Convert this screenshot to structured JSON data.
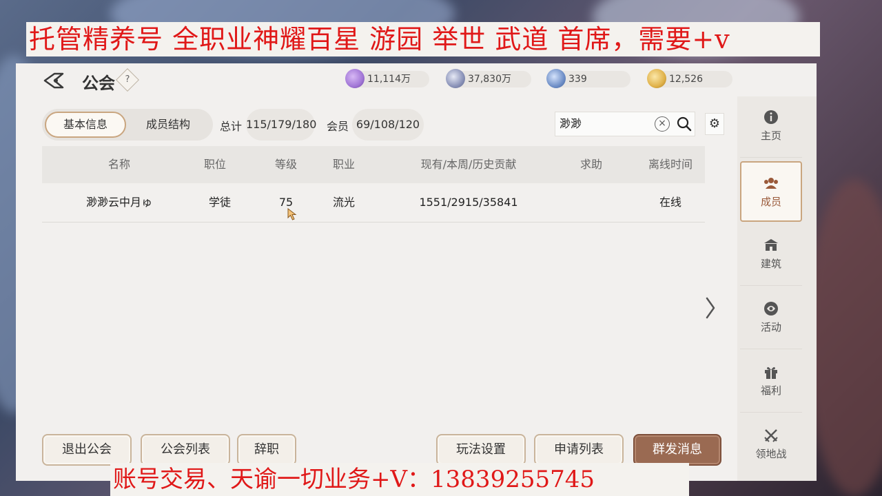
{
  "banner_top": "托管精养号 全职业神耀百星 游园 举世 武道 首席，需要+v",
  "banner_bottom": "账号交易、天谕一切业务+V：13839255745",
  "header": {
    "title": "公会",
    "help": "?",
    "resources": [
      {
        "value": "11,114万",
        "icon": "purple-crystal-icon",
        "color": "#a277d6"
      },
      {
        "value": "37,830万",
        "icon": "silver-coin-icon",
        "color": "#8a92b8"
      },
      {
        "value": "339",
        "icon": "blue-gem-icon",
        "color": "#6f8fc7"
      },
      {
        "value": "12,526",
        "icon": "gold-coin-icon",
        "color": "#e0b24a"
      }
    ]
  },
  "tabs": {
    "basic": "基本信息",
    "structure": "成员结构"
  },
  "stats": {
    "total_label": "总计",
    "total_value": "115/179/180",
    "member_label": "会员",
    "member_value": "69/108/120"
  },
  "search": {
    "value": "渺渺",
    "clear": "×"
  },
  "table": {
    "headers": [
      "名称",
      "职位",
      "等级",
      "职业",
      "现有/本周/历史贡献",
      "求助",
      "离线时间"
    ],
    "rows": [
      {
        "name": "渺渺云中月ゅ",
        "position": "学徒",
        "level": "75",
        "class": "流光",
        "contribution": "1551/2915/35841",
        "help": "",
        "offline": "在线"
      }
    ]
  },
  "buttons": {
    "quit": "退出公会",
    "guild_list": "公会列表",
    "resign": "辞职",
    "play_settings": "玩法设置",
    "apply_list": "申请列表",
    "broadcast": "群发消息"
  },
  "sidenav": [
    {
      "label": "主页",
      "icon": "info-icon"
    },
    {
      "label": "成员",
      "icon": "members-icon",
      "active": true
    },
    {
      "label": "建筑",
      "icon": "building-icon"
    },
    {
      "label": "活动",
      "icon": "activity-icon"
    },
    {
      "label": "福利",
      "icon": "gift-icon"
    },
    {
      "label": "领地战",
      "icon": "crossed-swords-icon"
    }
  ],
  "colors": {
    "accent": "#c9a57f",
    "primary_button": "#9a6a52",
    "banner_text": "#e01818"
  }
}
